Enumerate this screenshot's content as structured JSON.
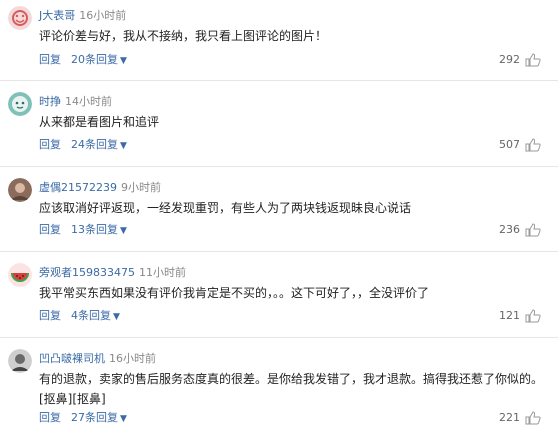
{
  "comments": [
    {
      "username": "J大表哥",
      "time": "16小时前",
      "text": "评论价差与好，我从不接纳，我只看上图评论的图片！",
      "reply": "回复",
      "replies": "20条回复",
      "likes": "292"
    },
    {
      "username": "时挣",
      "time": "14小时前",
      "text": "从来都是看图片和追评",
      "reply": "回复",
      "replies": "24条回复",
      "likes": "507"
    },
    {
      "username": "虚偶21572239",
      "time": "9小时前",
      "text": "应该取消好评返现，一经发现重罚，有些人为了两块钱返现昧良心说话",
      "reply": "回复",
      "replies": "13条回复",
      "likes": "236"
    },
    {
      "username": "旁观者159833475",
      "time": "11小时前",
      "text": "我平常买东西如果没有评价我肯定是不买的，。。这下可好了，，全没评价了",
      "reply": "回复",
      "replies": "4条回复",
      "likes": "121"
    },
    {
      "username": "凹凸啵裸司机",
      "time": "16小时前",
      "text": "有的退款，卖家的售后服务态度真的很差。是你给我发错了，我才退款。搞得我还惹了你似的。[抠鼻][抠鼻]",
      "reply": "回复",
      "replies": "27条回复",
      "likes": "221"
    }
  ],
  "colors": {
    "link": "#3b6aa6",
    "time": "#888888",
    "divider": "#e6e6e6"
  }
}
